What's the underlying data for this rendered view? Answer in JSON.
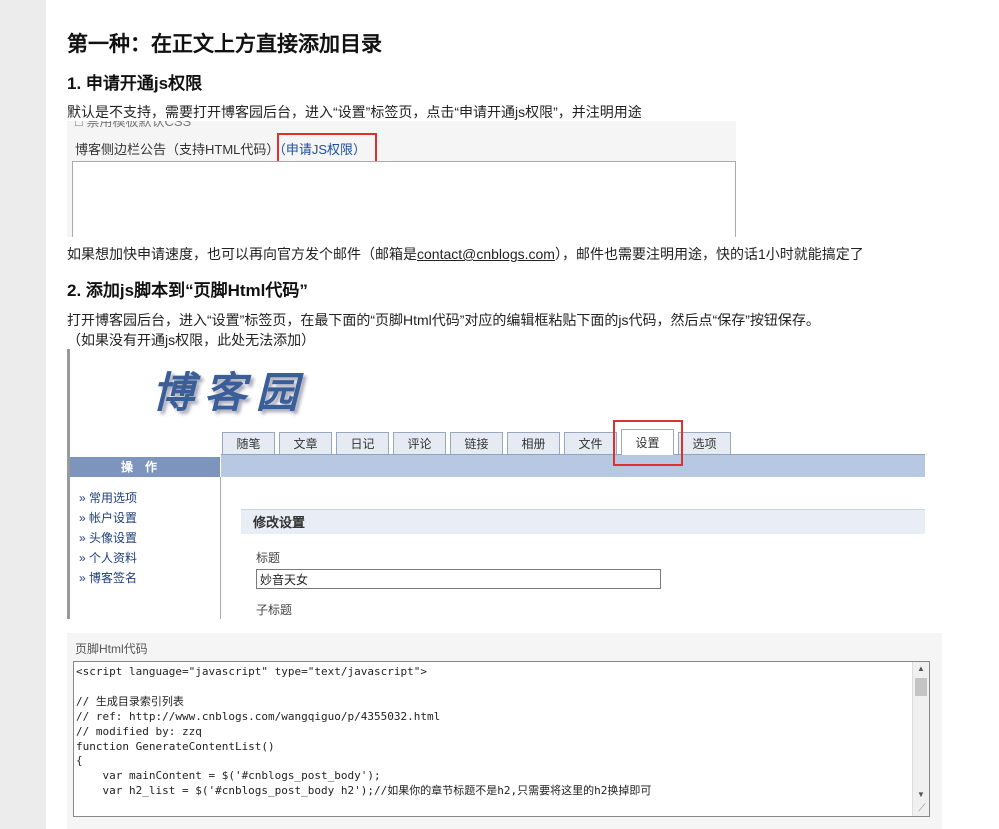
{
  "heading": "第一种：在正文上方直接添加目录",
  "section1": {
    "title": "1. 申请开通js权限",
    "desc": "默认是不支持，需要打开博客园后台，进入“设置”标签页，点击“申请开通js权限”，并注明用途",
    "shot": {
      "cut_text": "□ 禁用模板默认CSS",
      "label": "博客侧边栏公告（支持HTML代码）",
      "link": "（申请JS权限）"
    },
    "after_text_before": "如果想加快申请速度，也可以再向官方发个邮件（邮箱是",
    "email": "contact@cnblogs.com",
    "after_text_after": "），邮件也需要注明用途，快的话1小时就能搞定了"
  },
  "section2": {
    "title": "2. 添加js脚本到“页脚Html代码”",
    "desc": "打开博客园后台，进入“设置”标签页，在最下面的“页脚Html代码”对应的编辑框粘贴下面的js代码，然后点“保存”按钮保存。",
    "note": "（如果没有开通js权限，此处无法添加）",
    "shot": {
      "logo": "博客园",
      "tabs": [
        "随笔",
        "文章",
        "日记",
        "评论",
        "链接",
        "相册",
        "文件",
        "设置",
        "选项"
      ],
      "active_tab": "设置",
      "side_header": "操作",
      "side_items": [
        "» 常用选项",
        "» 帐户设置",
        "» 头像设置",
        "» 个人资料",
        "» 博客签名"
      ],
      "panel_title": "修改设置",
      "field1_label": "标题",
      "field1_value": "妙音天女",
      "field2_label": "子标题"
    },
    "code_shot": {
      "label": "页脚Html代码",
      "code": "<script language=\"javascript\" type=\"text/javascript\">\n\n// 生成目录索引列表\n// ref: http://www.cnblogs.com/wangqiguo/p/4355032.html\n// modified by: zzq\nfunction GenerateContentList()\n{\n    var mainContent = $('#cnblogs_post_body');\n    var h2_list = $('#cnblogs_post_body h2');//如果你的章节标题不是h2,只需要将这里的h2换掉即可"
    }
  }
}
